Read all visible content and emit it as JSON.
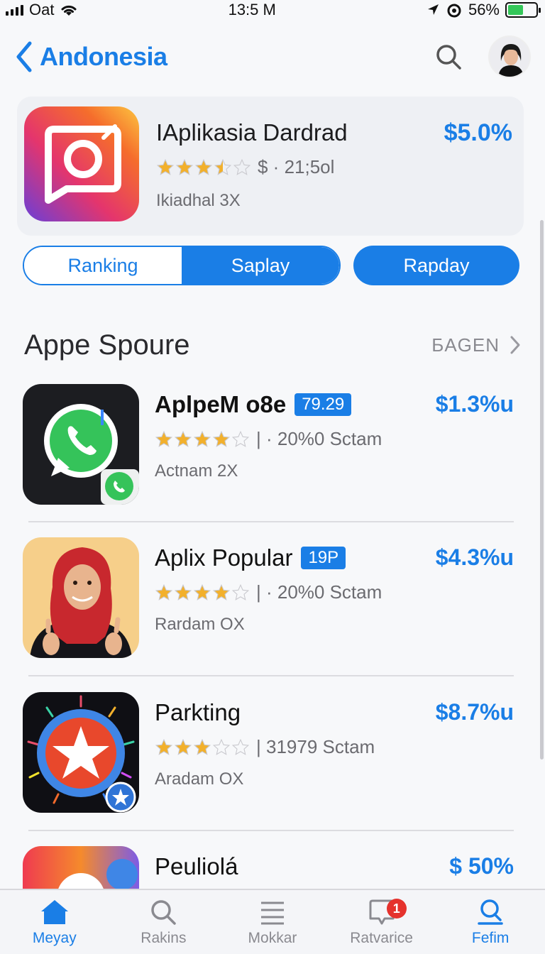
{
  "status_bar": {
    "carrier": "Oat",
    "time": "13:5 M",
    "battery_percent": "56%",
    "battery_level": 0.56
  },
  "nav": {
    "title": "Andonesia",
    "back_icon": "chevron-left-icon",
    "search_icon": "search-icon"
  },
  "featured": {
    "title": "IAplikasia Dardrad",
    "rating_meta": "$ · 21;5ol",
    "rating": 3.5,
    "subtitle": "Ikiadhal 3X",
    "price": "$5.0%"
  },
  "segments": {
    "left_label": "Ranking",
    "middle_label": "Saplay",
    "right_label": "Rapday"
  },
  "section": {
    "title": "Appe Spoure",
    "link_label": "БAGEN"
  },
  "apps": [
    {
      "title": "AplpeM o8e",
      "badge": "79.29",
      "rating": 4,
      "meta": "| · 20%0 Sctam",
      "subtitle": "Actnam 2X",
      "price": "$1.3%u",
      "icon": "whatsapp-icon"
    },
    {
      "title": "Aplix Popular",
      "badge": "19P",
      "rating": 4,
      "meta": "| · 20%0 Sctam",
      "subtitle": "Rardam OX",
      "price": "$4.3%u",
      "icon": "person-photo-icon"
    },
    {
      "title": "Parkting",
      "badge": "",
      "rating": 3,
      "meta": "| 31979 Sctam",
      "subtitle": "Aradam OX",
      "price": "$8.7%u",
      "icon": "star-burst-icon"
    },
    {
      "title": "Peuliolá",
      "badge": "",
      "rating": 0,
      "meta": "",
      "subtitle": "",
      "price": "$ 50%",
      "icon": "colorful-gear-icon"
    }
  ],
  "tab_bar": {
    "items": [
      {
        "label": "Meyay",
        "icon": "home-icon",
        "active": true
      },
      {
        "label": "Rakins",
        "icon": "search-icon",
        "active": false
      },
      {
        "label": "Mokkar",
        "icon": "list-icon",
        "active": false
      },
      {
        "label": "Ratvarice",
        "icon": "notification-icon",
        "active": false,
        "badge": "1"
      },
      {
        "label": "Fefim",
        "icon": "search-icon",
        "active": true
      }
    ]
  },
  "colors": {
    "accent": "#1a7ee6",
    "star": "#f2b02c",
    "badge_red": "#e5322d"
  }
}
